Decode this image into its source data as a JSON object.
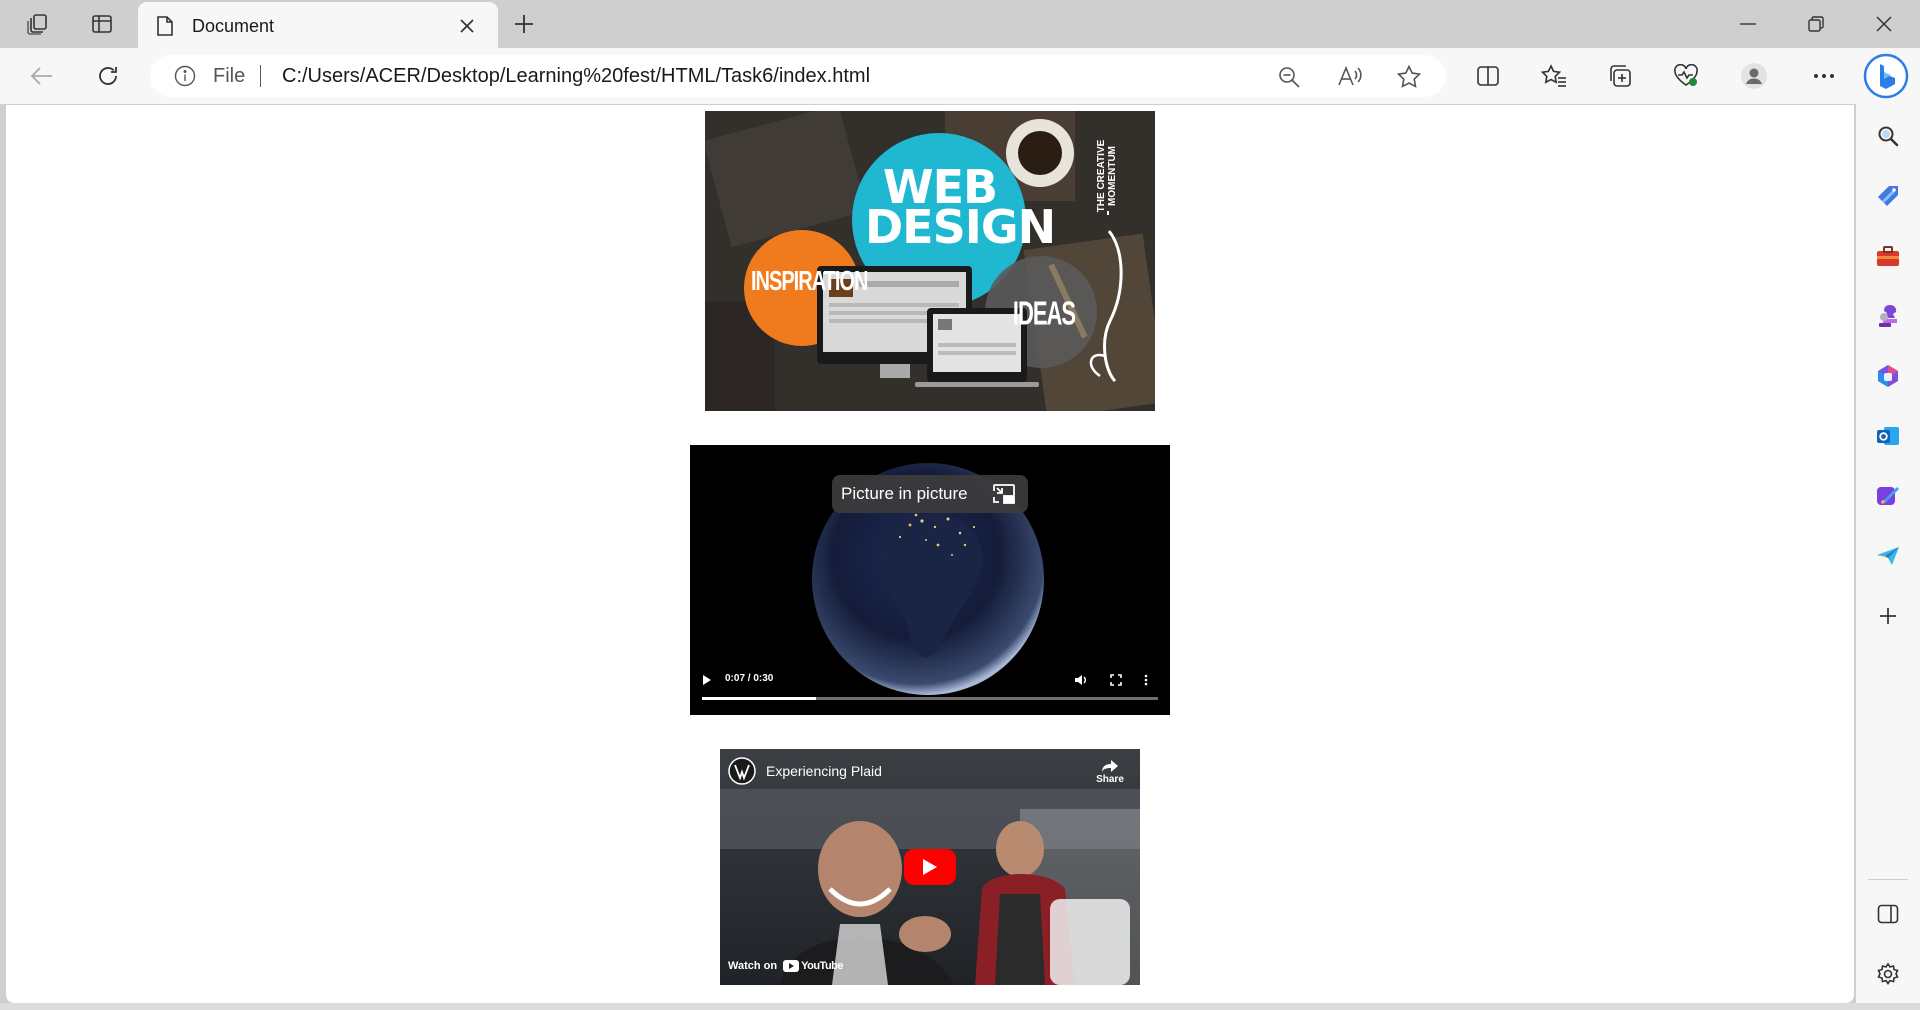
{
  "window": {
    "tab_title": "Document",
    "controls": [
      "minimize-icon",
      "restore-icon",
      "close-icon"
    ]
  },
  "toolbar": {
    "address_prefix": "File",
    "url": "C:/Users/ACER/Desktop/Learning%20fest/HTML/Task6/index.html"
  },
  "page": {
    "hero_image": {
      "main_heading": "WEB DESIGN",
      "word_left": "INSPIRATION",
      "word_right": "IDEAS",
      "vertical_text": "THE CREATIVE MOMENTUM"
    },
    "video": {
      "pip_label": "Picture in picture",
      "time": "0:07 / 0:30",
      "progress": 0.25
    },
    "youtube": {
      "title": "Experiencing Plaid",
      "share_label": "Share",
      "watch_on": "Watch on",
      "brand": "YouTube"
    }
  },
  "colors": {
    "accent_blue": "#0078d4",
    "youtube_red": "#ff0000",
    "web_design_circle": "#1fb8d0",
    "inspiration_circle": "#f07a1e"
  }
}
